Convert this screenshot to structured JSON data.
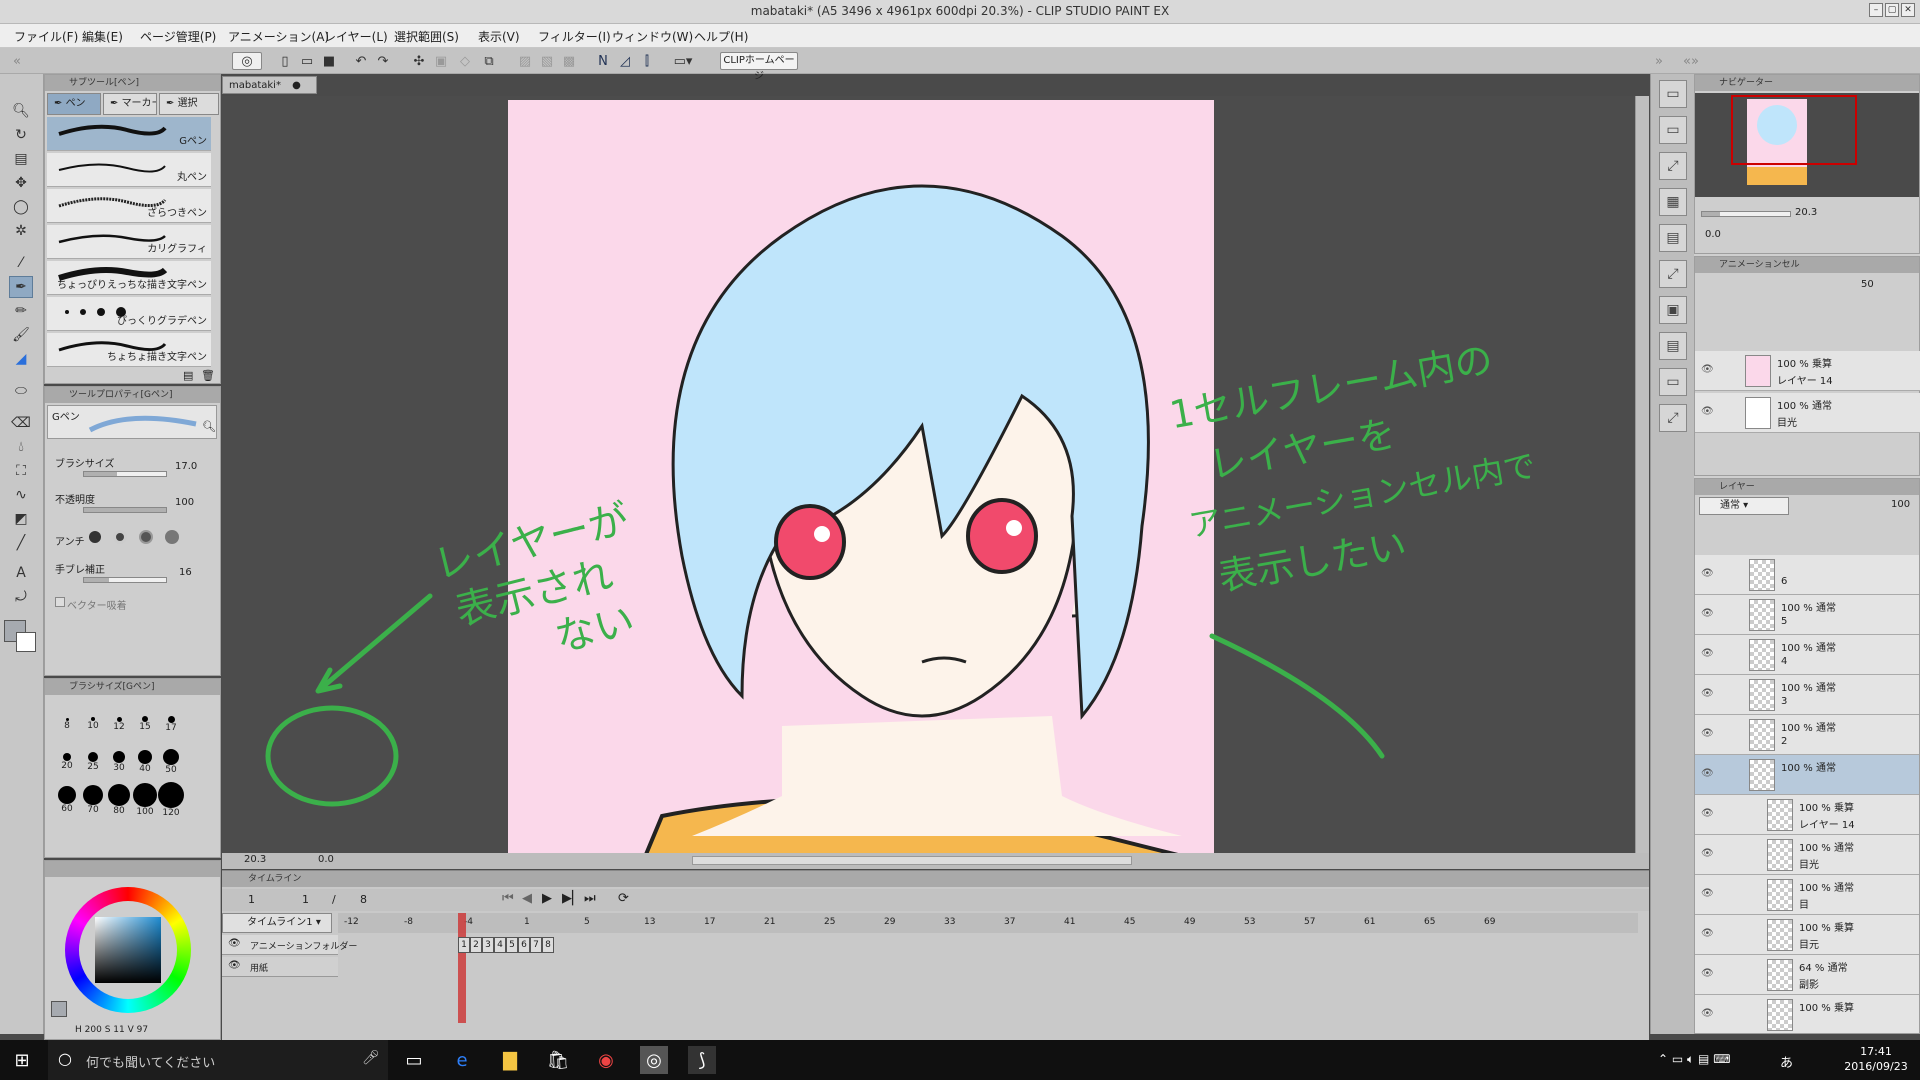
{
  "window": {
    "title": "mabataki* (A5 3496 x 4961px 600dpi 20.3%) - CLIP STUDIO PAINT EX"
  },
  "menu": [
    "ファイル(F)",
    "編集(E)",
    "ページ管理(P)",
    "アニメーション(A)",
    "レイヤー(L)",
    "選択範囲(S)",
    "表示(V)",
    "フィルター(I)",
    "ウィンドウ(W)",
    "ヘルプ(H)"
  ],
  "toolbar": {
    "homepage_label": "CLIPホームページ"
  },
  "subtool": {
    "header": "サブツール[ペン]",
    "tabs": [
      "ペン",
      "マーカー",
      "選択"
    ],
    "brushes": [
      "Gペン",
      "丸ペン",
      "ざらつきペン",
      "カリグラフィ",
      "ちょっぴりえっちな描き文字ペン",
      "ぴっくりグラデペン",
      "ちょちょ描き文字ペン"
    ]
  },
  "toolprop": {
    "header": "ツールプロパティ[Gペン]",
    "brush_name": "Gペン",
    "size_label": "ブラシサイズ",
    "size_value": "17.0",
    "opacity_label": "不透明度",
    "opacity_value": "100",
    "antialias_label": "アンチ",
    "stabilizer_label": "手ブレ補正",
    "stabilizer_value": "16",
    "vector_label": "ベクター吸着"
  },
  "brushsize": {
    "header": "ブラシサイズ[Gペン]",
    "sizes": [
      "8",
      "10",
      "12",
      "15",
      "17",
      "20",
      "25",
      "30",
      "40",
      "50",
      "60",
      "70",
      "80",
      "100",
      "120"
    ]
  },
  "color": {
    "h": "200",
    "s": "11",
    "v": "97",
    "main_color": "#a6aab0",
    "sub_color": "#ffffff"
  },
  "document": {
    "tab_label": "mabataki*",
    "canvas_bg": "#fbd8ea",
    "zoom": "20.3",
    "rotation": "0.0"
  },
  "timeline": {
    "header": "タイムライン",
    "frame_start": "1",
    "frame_current": "1",
    "frame_sep": "/",
    "frame_end": "8",
    "timeline_name": "タイムライン1",
    "ruler": [
      "-12",
      "-8",
      "-4",
      "1",
      "5",
      "13",
      "17",
      "21",
      "25",
      "29",
      "33",
      "37",
      "41",
      "45",
      "49",
      "53",
      "57",
      "61",
      "65",
      "69"
    ],
    "tracks": [
      "アニメーションフォルダー",
      "用紙"
    ],
    "cels": [
      "1",
      "2",
      "3",
      "4",
      "5",
      "6",
      "7",
      "8"
    ]
  },
  "navigator": {
    "header": "ナビゲーター",
    "zoom": "20.3",
    "rotation": "0.0"
  },
  "animcel": {
    "header": "アニメーションセル",
    "opacity": "50",
    "rows": [
      {
        "mode": "100 % 乗算",
        "name": "レイヤー 14"
      },
      {
        "mode": "100 % 通常",
        "name": "目光"
      }
    ]
  },
  "layers": {
    "header": "レイヤー",
    "blend": "通常",
    "opacity": "100",
    "rows": [
      {
        "mode": "",
        "name": "6"
      },
      {
        "mode": "100 % 通常",
        "name": "5"
      },
      {
        "mode": "100 % 通常",
        "name": "4"
      },
      {
        "mode": "100 % 通常",
        "name": "3"
      },
      {
        "mode": "100 % 通常",
        "name": "2"
      },
      {
        "mode": "100 % 通常",
        "name": ""
      },
      {
        "mode": "100 % 乗算",
        "name": "レイヤー 14"
      },
      {
        "mode": "100 % 通常",
        "name": "目光"
      },
      {
        "mode": "100 % 通常",
        "name": "目"
      },
      {
        "mode": "100 % 乗算",
        "name": "目元"
      },
      {
        "mode": "64 % 通常",
        "name": "副影"
      },
      {
        "mode": "100 % 乗算",
        "name": ""
      }
    ]
  },
  "annotations": {
    "left": [
      "レイヤーが",
      "表示され",
      "ない"
    ],
    "right": [
      "1セルフレーム内の",
      "レイヤーを",
      "アニメーションセル内で",
      "表示したい"
    ],
    "color": "#3bb04a"
  },
  "taskbar": {
    "search_placeholder": "何でも聞いてください",
    "time": "17:41",
    "date": "2016/09/23",
    "ime": "あ"
  }
}
